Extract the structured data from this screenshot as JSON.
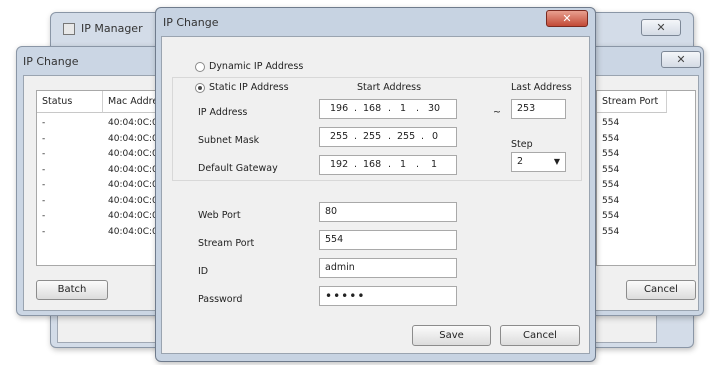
{
  "ip_manager": {
    "title": "IP Manager",
    "close": "✕"
  },
  "left_dialog": {
    "title": "IP Change",
    "columns": [
      "Status",
      "Mac Address"
    ],
    "rows": [
      {
        "status": "-",
        "mac": "40:04:0C:0"
      },
      {
        "status": "-",
        "mac": "40:04:0C:0"
      },
      {
        "status": "-",
        "mac": "40:04:0C:0"
      },
      {
        "status": "-",
        "mac": "40:04:0C:0"
      },
      {
        "status": "-",
        "mac": "40:04:0C:0"
      },
      {
        "status": "-",
        "mac": "40:04:0C:0"
      },
      {
        "status": "-",
        "mac": "40:04:0C:0"
      },
      {
        "status": "-",
        "mac": "40:04:0C:0"
      }
    ],
    "batch_label": "Batch"
  },
  "right_dialog": {
    "column": "Stream Port",
    "rows": [
      "554",
      "554",
      "554",
      "554",
      "554",
      "554",
      "554",
      "554"
    ],
    "cancel_label": "Cancel",
    "close": "✕"
  },
  "main_dialog": {
    "title": "IP Change",
    "close": "✕",
    "dynamic_label": "Dynamic IP Address",
    "static_label": "Static IP Address",
    "start_header": "Start Address",
    "last_header": "Last Address",
    "ip_label": "IP Address",
    "ip": [
      "196",
      "168",
      "1",
      "30"
    ],
    "tilde": "~",
    "last_value": "253",
    "subnet_label": "Subnet Mask",
    "subnet": [
      "255",
      "255",
      "255",
      "0"
    ],
    "gateway_label": "Default Gateway",
    "gateway": [
      "192",
      "168",
      "1",
      "1"
    ],
    "step_label": "Step",
    "step_value": "2",
    "web_port_label": "Web Port",
    "web_port": "80",
    "stream_port_label": "Stream Port",
    "stream_port": "554",
    "id_label": "ID",
    "id": "admin",
    "password_label": "Password",
    "password": "•••••",
    "save_label": "Save",
    "cancel_label": "Cancel"
  }
}
